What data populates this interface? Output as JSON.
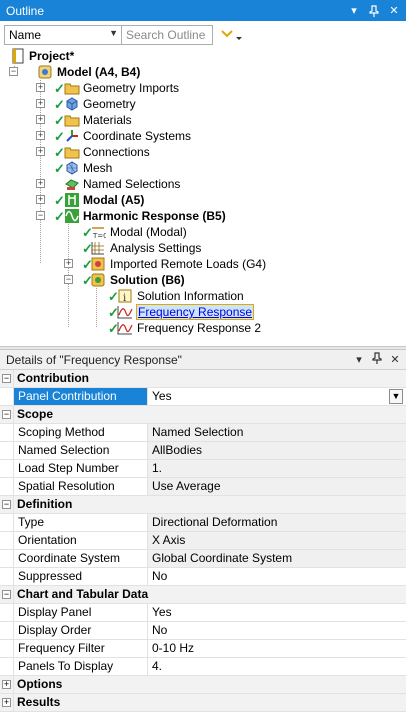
{
  "outline": {
    "title": "Outline",
    "controls": {
      "pin": "▾",
      "autohide": "⊥",
      "close": "✕"
    },
    "name_select": "Name",
    "search_placeholder": "Search Outline"
  },
  "tree": {
    "project": "Project*",
    "model": "Model (A4, B4)",
    "geometry_imports": "Geometry Imports",
    "geometry": "Geometry",
    "materials": "Materials",
    "coordinate_systems": "Coordinate Systems",
    "connections": "Connections",
    "mesh": "Mesh",
    "named_selections": "Named Selections",
    "modal": "Modal (A5)",
    "harmonic": "Harmonic Response (B5)",
    "modal_modal": "Modal (Modal)",
    "analysis_settings": "Analysis Settings",
    "imported_remote_loads": "Imported Remote Loads (G4)",
    "solution": "Solution (B6)",
    "solution_information": "Solution Information",
    "frequency_response": "Frequency Response",
    "frequency_response_2": "Frequency Response 2"
  },
  "details": {
    "title": "Details of \"Frequency Response\"",
    "controls": {
      "pin": "▾",
      "autohide": "⊥",
      "close": "✕"
    },
    "sections": {
      "contribution": "Contribution",
      "scope": "Scope",
      "definition": "Definition",
      "chart": "Chart and Tabular Data",
      "options": "Options",
      "results": "Results"
    },
    "rows": {
      "panel_contribution": {
        "k": "Panel Contribution",
        "v": "Yes"
      },
      "scoping_method": {
        "k": "Scoping Method",
        "v": "Named Selection"
      },
      "named_selection": {
        "k": "Named Selection",
        "v": "AllBodies"
      },
      "load_step_number": {
        "k": "Load Step Number",
        "v": "1."
      },
      "spatial_resolution": {
        "k": "Spatial Resolution",
        "v": "Use Average"
      },
      "type": {
        "k": "Type",
        "v": "Directional Deformation"
      },
      "orientation": {
        "k": "Orientation",
        "v": "X Axis"
      },
      "coordinate_system": {
        "k": "Coordinate System",
        "v": "Global Coordinate System"
      },
      "suppressed": {
        "k": "Suppressed",
        "v": "No"
      },
      "display_panel": {
        "k": "Display Panel",
        "v": "Yes"
      },
      "display_order": {
        "k": "Display Order",
        "v": "No"
      },
      "frequency_filter": {
        "k": "Frequency Filter",
        "v": "0-10 Hz"
      },
      "panels_to_display": {
        "k": "Panels To Display",
        "v": "4."
      }
    }
  },
  "colors": {
    "accent": "#1883d7",
    "check": "#1a9e3a",
    "highlight": "#cce4f7"
  }
}
